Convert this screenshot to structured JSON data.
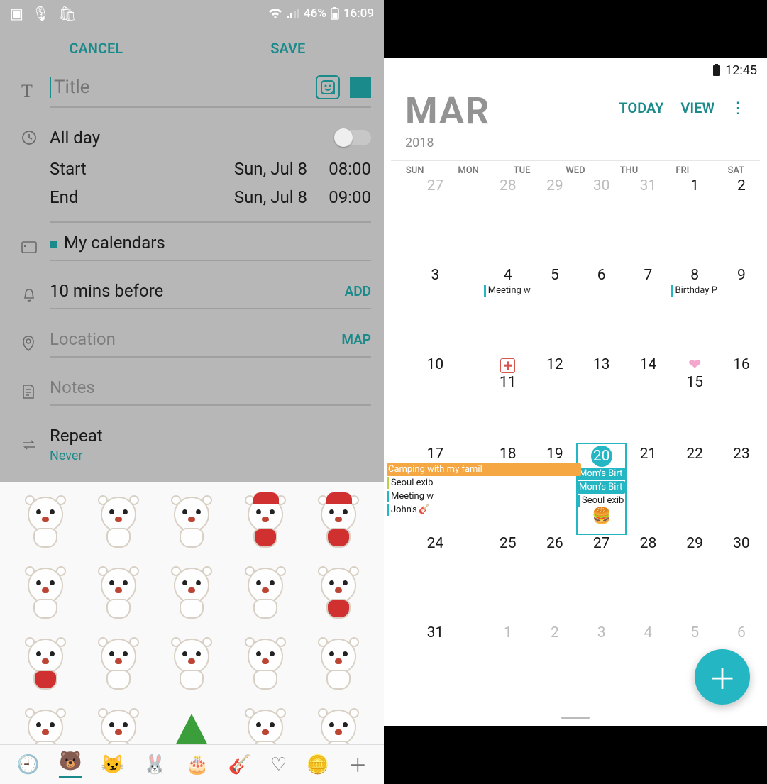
{
  "left": {
    "status": {
      "icons": [
        "image-icon",
        "mic-icon",
        "bag-icon"
      ],
      "wifi": "wifi",
      "battery_pct": "46%",
      "time": "16:09"
    },
    "actions": {
      "cancel": "CANCEL",
      "save": "SAVE"
    },
    "title": {
      "placeholder": "Title"
    },
    "allday": {
      "label": "All day",
      "on": false
    },
    "start": {
      "label": "Start",
      "date": "Sun, Jul 8",
      "time": "08:00"
    },
    "end": {
      "label": "End",
      "date": "Sun, Jul 8",
      "time": "09:00"
    },
    "calendar": {
      "label": "My calendars"
    },
    "reminder": {
      "label": "10 mins before",
      "action": "ADD"
    },
    "location": {
      "placeholder": "Location",
      "action": "MAP"
    },
    "notes": {
      "placeholder": "Notes"
    },
    "repeat": {
      "label": "Repeat",
      "value": "Never"
    },
    "sticker_tabs": [
      "recent",
      "bear-pack",
      "cat-pack",
      "bunny-pack",
      "cake-pack",
      "guitar-pack",
      "heart-pack",
      "coin-pack",
      "add-pack"
    ]
  },
  "right": {
    "status": {
      "time": "12:45"
    },
    "header": {
      "month": "MAR",
      "year": "2018",
      "today": "TODAY",
      "view": "VIEW"
    },
    "dow": [
      "SUN",
      "MON",
      "TUE",
      "WED",
      "THU",
      "FRI",
      "SAT"
    ],
    "weeks": [
      [
        {
          "n": "27",
          "out": true
        },
        {
          "n": "28",
          "out": true
        },
        {
          "n": "29",
          "out": true
        },
        {
          "n": "30",
          "out": true
        },
        {
          "n": "31",
          "out": true
        },
        {
          "n": "1"
        },
        {
          "n": "2"
        }
      ],
      [
        {
          "n": "3"
        },
        {
          "n": "4",
          "events": [
            {
              "txt": "Meeting w",
              "color": "#25b6c4",
              "style": "bar"
            }
          ]
        },
        {
          "n": "5"
        },
        {
          "n": "6"
        },
        {
          "n": "7"
        },
        {
          "n": "8",
          "events": [
            {
              "txt": "Birthday P",
              "color": "#25b6c4",
              "style": "bar"
            }
          ]
        },
        {
          "n": "9"
        }
      ],
      [
        {
          "n": "10"
        },
        {
          "n": "11",
          "topIcon": "✚",
          "topIconColor": "#d9534f"
        },
        {
          "n": "12"
        },
        {
          "n": "13"
        },
        {
          "n": "14"
        },
        {
          "n": "15",
          "topIcon": "❤",
          "topIconColor": "#f4a6cc"
        },
        {
          "n": "16"
        }
      ],
      [
        {
          "n": "17",
          "events": [
            {
              "txt": "Camping with my famil",
              "color": "#f4a742",
              "style": "fill",
              "span": 2
            },
            {
              "txt": "Seoul exib",
              "color": "#b9d24a",
              "style": "bar"
            },
            {
              "txt": "Meeting w",
              "color": "#25b6c4",
              "style": "bar"
            },
            {
              "txt": "John's",
              "color": "#25b6c4",
              "style": "bar",
              "emoji": "🎸"
            }
          ]
        },
        {
          "n": "18"
        },
        {
          "n": "19"
        },
        {
          "n": "20",
          "today": true,
          "events": [
            {
              "txt": "Mom's Birt",
              "color": "#25b6c4",
              "style": "fill"
            },
            {
              "txt": "Mom's Birt",
              "color": "#25b6c4",
              "style": "fill"
            },
            {
              "txt": "Seoul exib",
              "color": "#25b6c4",
              "style": "bar"
            }
          ],
          "bottomEmoji": "🍔"
        },
        {
          "n": "21"
        },
        {
          "n": "22"
        },
        {
          "n": "23"
        }
      ],
      [
        {
          "n": "24"
        },
        {
          "n": "25"
        },
        {
          "n": "26"
        },
        {
          "n": "27"
        },
        {
          "n": "28"
        },
        {
          "n": "29"
        },
        {
          "n": "30"
        }
      ],
      [
        {
          "n": "31"
        },
        {
          "n": "1",
          "out": true
        },
        {
          "n": "2",
          "out": true
        },
        {
          "n": "3",
          "out": true
        },
        {
          "n": "4",
          "out": true
        },
        {
          "n": "5",
          "out": true
        },
        {
          "n": "6",
          "out": true
        }
      ]
    ]
  }
}
